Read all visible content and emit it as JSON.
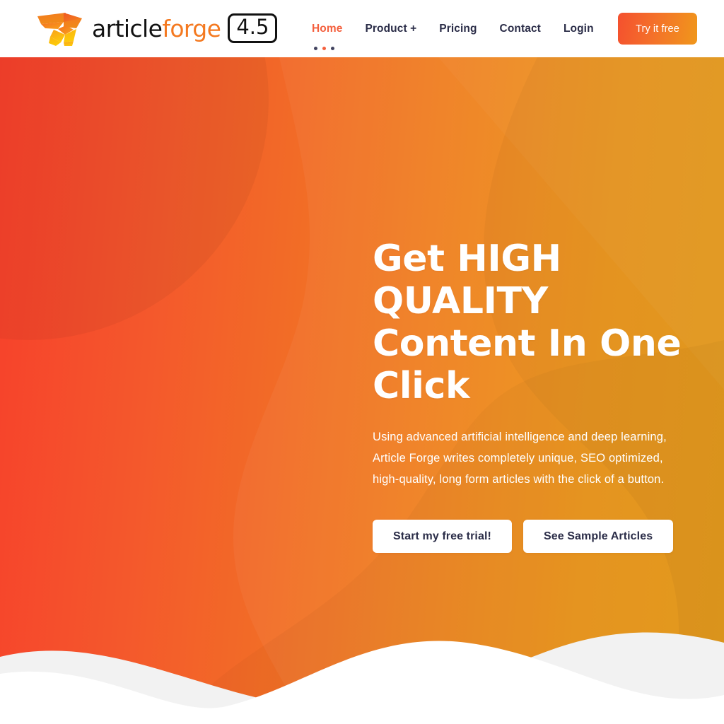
{
  "header": {
    "logo": {
      "icon_name": "articleforge-bird-logo",
      "text_primary": "article",
      "text_accent": "forge",
      "version_badge": "4.5"
    },
    "nav_items": [
      {
        "label": "Home",
        "active": true
      },
      {
        "label": "Product +",
        "active": false
      },
      {
        "label": "Pricing",
        "active": false
      },
      {
        "label": "Contact",
        "active": false
      },
      {
        "label": "Login",
        "active": false
      }
    ],
    "cta_button": "Try it free"
  },
  "hero": {
    "title_line1": "Get HIGH QUALITY",
    "title_line2": "Content In One Click",
    "subtitle": "Using advanced artificial intelligence and deep learning, Article Forge writes completely unique, SEO optimized, high-quality, long form articles with the click of a button.",
    "primary_button": "Start my free trial!",
    "secondary_button": "See Sample Articles"
  },
  "colors": {
    "accent_orange": "#F47920",
    "active_nav": "#F4603E",
    "nav_text": "#2B2D48",
    "gradient_start": "#F7402B",
    "gradient_end": "#E99B14",
    "button_text": "#2B2D48",
    "hero_text": "#FFFFFF"
  }
}
